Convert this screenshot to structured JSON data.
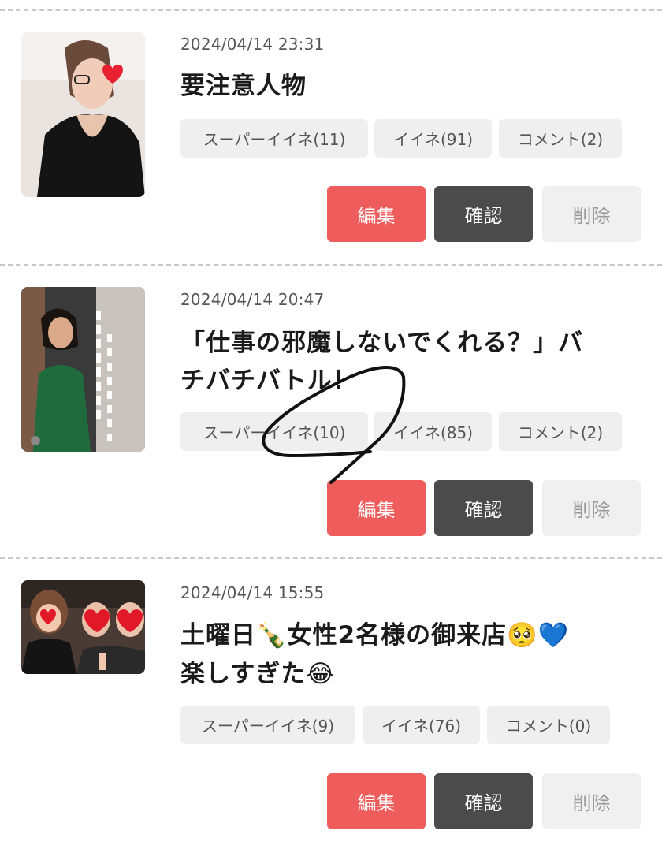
{
  "posts": [
    {
      "date": "2024/04/14 23:31",
      "title": "要注意人物",
      "super_like": "スーパーイイネ(11)",
      "like": "イイネ(91)",
      "comment": "コメント(2)",
      "edit": "編集",
      "confirm": "確認",
      "delete": "削除"
    },
    {
      "date": "2024/04/14 20:47",
      "title_line1": "「仕事の邪魔しないでくれる？」バ",
      "title_line2": "チバチバトル！",
      "super_like": "スーパーイイネ(10)",
      "like": "イイネ(85)",
      "comment": "コメント(2)",
      "edit": "編集",
      "confirm": "確認",
      "delete": "削除"
    },
    {
      "date": "2024/04/14 15:55",
      "title_line1": "土曜日🍾女性2名様の御来店🥺💙",
      "title_line2": "楽しすぎた😂",
      "super_like": "スーパーイイネ(9)",
      "like": "イイネ(76)",
      "comment": "コメント(0)",
      "edit": "編集",
      "confirm": "確認",
      "delete": "削除"
    }
  ],
  "colors": {
    "edit_bg": "#ee5c5c",
    "confirm_bg": "#4b4b4b",
    "delete_bg": "#f0f0f0",
    "chip_bg": "#efefef"
  }
}
